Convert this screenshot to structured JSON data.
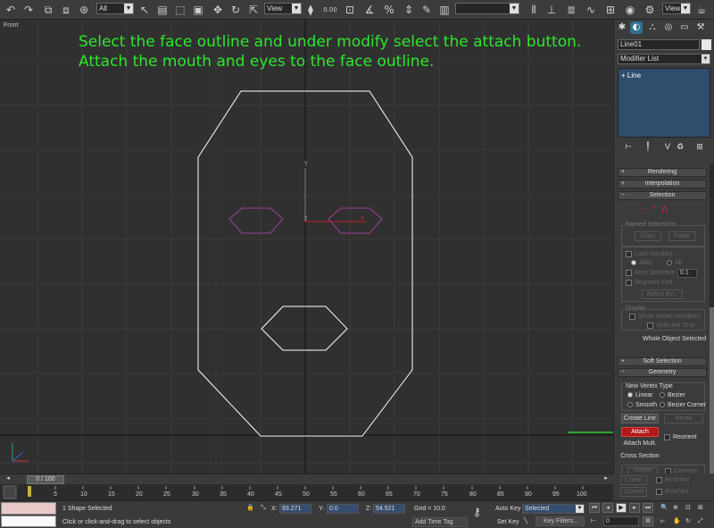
{
  "toolbar": {
    "selection_filter": "All",
    "reference_coord": "View",
    "snap_value": "0.00",
    "named_selection": "",
    "view_dropdown": "View"
  },
  "viewport": {
    "label": "Front",
    "instruction": "Select the face outline and under modify select the attach button.  Attach the mouth and eyes to the face outline.",
    "axis_y": "y",
    "axis_z": "z",
    "axis_x": "x"
  },
  "command_panel": {
    "object_name": "Line01",
    "modifier_list": "Modifier List",
    "stack_item": "Line",
    "rollouts": {
      "rendering": "Rendering",
      "interpolation": "Interpolation",
      "selection": "Selection",
      "soft_selection": "Soft Selection",
      "geometry": "Geometry"
    },
    "named_selections_title": "Named Selections",
    "copy_label": "Copy",
    "paste_label": "Paste",
    "lock_handles": "Lock Handles",
    "alike": "Alike",
    "all": "All",
    "area_selection": "Area Selection",
    "area_value": "0.1",
    "segment_end": "Segment End",
    "select_by": "Select By...",
    "display_title": "Display",
    "show_vertex_numbers": "Show Vertex Numbers",
    "selected_only": "Selected Only",
    "whole_object_selected": "Whole Object Selected",
    "new_vertex_type": "New Vertex Type",
    "linear": "Linear",
    "bezier": "Bezier",
    "smooth": "Smooth",
    "bezier_corner": "Bezier Corner",
    "create_line": "Create Line",
    "break": "Break",
    "attach": "Attach",
    "reorient": "Reorient",
    "attach_mult": "Attach Mult.",
    "cross_section": "Cross Section",
    "refine": "Refine",
    "connect": "Connect",
    "linear2": "Linear",
    "bind_first": "Bind first",
    "closed": "Closed",
    "bind_last": "Bind last"
  },
  "timeline": {
    "slider_label": "0 / 100",
    "ticks": [
      "5",
      "10",
      "15",
      "20",
      "25",
      "30",
      "35",
      "40",
      "45",
      "50",
      "55",
      "60",
      "65",
      "70",
      "75",
      "80",
      "85",
      "90",
      "95",
      "100"
    ]
  },
  "status": {
    "selection_info": "1 Shape Selected",
    "prompt": "Click or click-and-drag to select objects",
    "x_label": "X:",
    "x_value": "93.271",
    "y_label": "Y:",
    "y_value": "0.0",
    "z_label": "Z:",
    "z_value": "54.521",
    "grid": "Grid = 10.0",
    "add_time_tag": "Add Time Tag",
    "auto_key": "Auto Key",
    "auto_key_mode": "Selected",
    "set_key": "Set Key",
    "key_filters": "Key Filters...",
    "frame": "0"
  }
}
